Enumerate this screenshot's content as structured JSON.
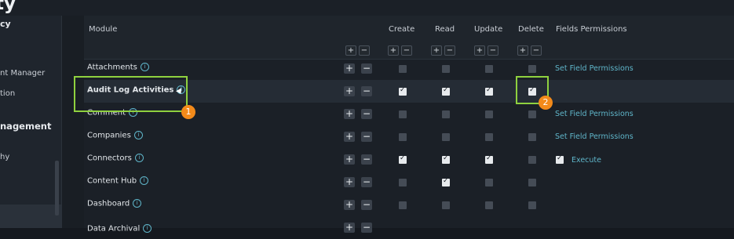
{
  "app": {
    "title": "ty"
  },
  "sidebar": {
    "items": [
      {
        "label": "cy"
      },
      {
        "label": "nt Manager"
      },
      {
        "label": "tion"
      },
      {
        "label": "nagement"
      },
      {
        "label": "hy"
      }
    ]
  },
  "table": {
    "headers": {
      "module": "Module",
      "create": "Create",
      "read": "Read",
      "update": "Update",
      "delete": "Delete",
      "fields_permissions": "Fields Permissions"
    },
    "plus": "+",
    "minus": "−",
    "rows": [
      {
        "module": "Attachments",
        "create": false,
        "read": false,
        "update": false,
        "delete": false,
        "action": "Set Field Permissions"
      },
      {
        "module": "Audit Log Activities",
        "create": true,
        "read": true,
        "update": true,
        "delete": true,
        "action": ""
      },
      {
        "module": "Comment",
        "create": false,
        "read": false,
        "update": false,
        "delete": false,
        "action": "Set Field Permissions"
      },
      {
        "module": "Companies",
        "create": false,
        "read": false,
        "update": false,
        "delete": false,
        "action": "Set Field Permissions"
      },
      {
        "module": "Connectors",
        "create": true,
        "read": true,
        "update": true,
        "delete": false,
        "action": "Execute",
        "action_checked": true
      },
      {
        "module": "Content Hub",
        "create": false,
        "read": true,
        "update": false,
        "delete": false,
        "action": ""
      },
      {
        "module": "Dashboard",
        "create": false,
        "read": false,
        "update": false,
        "delete": false,
        "action": ""
      },
      {
        "module": "Data Archival",
        "create": false,
        "read": false,
        "update": false,
        "delete": false,
        "action": ""
      }
    ]
  },
  "annotations": {
    "badge1": "1",
    "badge2": "2"
  },
  "colors": {
    "accent": "#5fb5c9",
    "highlight": "#8fd13f",
    "badge": "#f38a1a"
  }
}
